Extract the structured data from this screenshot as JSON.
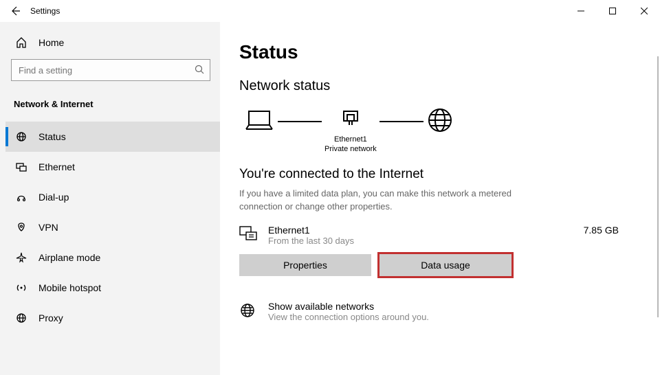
{
  "window": {
    "title": "Settings"
  },
  "sidebar": {
    "home_label": "Home",
    "search_placeholder": "Find a setting",
    "category": "Network & Internet",
    "items": [
      {
        "label": "Status",
        "selected": true
      },
      {
        "label": "Ethernet",
        "selected": false
      },
      {
        "label": "Dial-up",
        "selected": false
      },
      {
        "label": "VPN",
        "selected": false
      },
      {
        "label": "Airplane mode",
        "selected": false
      },
      {
        "label": "Mobile hotspot",
        "selected": false
      },
      {
        "label": "Proxy",
        "selected": false
      }
    ]
  },
  "main": {
    "title": "Status",
    "sub_heading": "Network status",
    "diagram": {
      "adapter_name": "Ethernet1",
      "adapter_type": "Private network"
    },
    "connected_title": "You're connected to the Internet",
    "connected_desc": "If you have a limited data plan, you can make this network a metered connection or change other properties.",
    "usage": {
      "name": "Ethernet1",
      "period": "From the last 30 days",
      "amount": "7.85 GB"
    },
    "buttons": {
      "properties": "Properties",
      "data_usage": "Data usage"
    },
    "show_networks": {
      "title": "Show available networks",
      "sub": "View the connection options around you."
    }
  }
}
